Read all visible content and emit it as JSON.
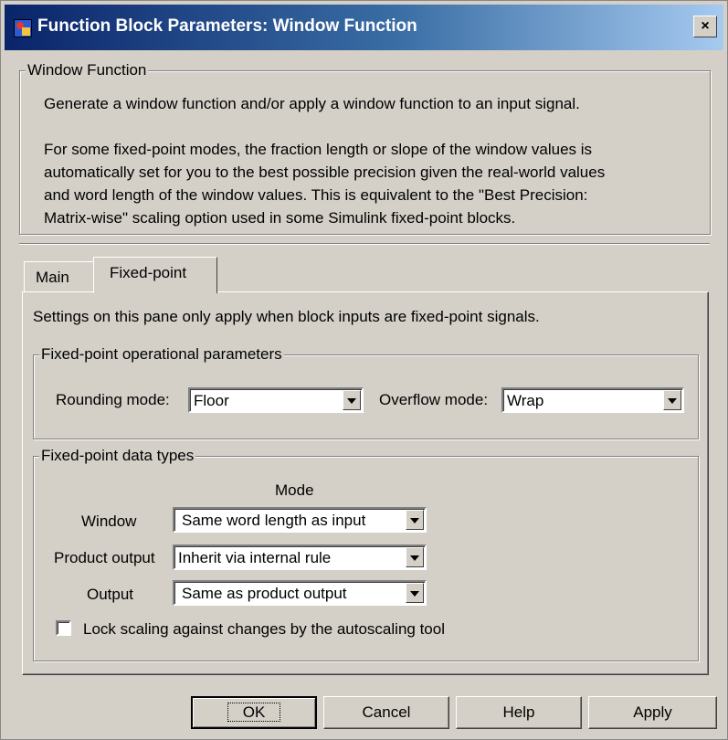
{
  "window": {
    "title": "Function Block Parameters: Window Function",
    "close_label": "×"
  },
  "description": {
    "group_title": "Window Function",
    "line1": "Generate a window function and/or apply a window function to an input signal.",
    "para2": [
      "For some fixed-point modes, the fraction length or slope of the window values is",
      "automatically set for you to the best possible precision given the real-world values",
      "and word length of the window values. This is equivalent to the \"Best Precision:",
      "Matrix-wise\" scaling option used in some Simulink fixed-point blocks."
    ]
  },
  "tabs": [
    {
      "label": "Main",
      "selected": false
    },
    {
      "label": "Fixed-point",
      "selected": true
    }
  ],
  "fixed_point": {
    "intro": "Settings on this pane only apply when block inputs are fixed-point signals.",
    "operational": {
      "group_title": "Fixed-point operational parameters",
      "rounding_label": "Rounding mode:",
      "rounding_value": "Floor",
      "overflow_label": "Overflow mode:",
      "overflow_value": "Wrap"
    },
    "data_types": {
      "group_title": "Fixed-point data types",
      "mode_header": "Mode",
      "rows": [
        {
          "label": "Window",
          "value": "Same word length as input"
        },
        {
          "label": "Product output",
          "value": "Inherit via internal rule"
        },
        {
          "label": "Output",
          "value": "Same as product output"
        }
      ],
      "lock_label": "Lock scaling against changes by the autoscaling tool",
      "lock_checked": false
    }
  },
  "buttons": {
    "ok": "OK",
    "cancel": "Cancel",
    "help": "Help",
    "apply": "Apply"
  },
  "colors": {
    "face": "#d4d0c8",
    "title_start": "#0a246a",
    "title_end": "#a6caf0"
  }
}
